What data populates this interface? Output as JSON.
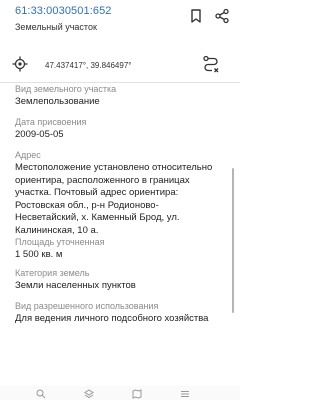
{
  "header": {
    "cadastral_number": "61:33:0030501:652",
    "subtitle": "Земельный участок",
    "bookmark_icon": "bookmark-icon",
    "share_icon": "share-icon",
    "accent_color": "#2f6fc9"
  },
  "location": {
    "coordinates": "47.437417°, 39.846497°",
    "target_icon": "crosshair-icon",
    "route_icon": "route-icon"
  },
  "fields": [
    {
      "label": "Вид земельного участка",
      "value": "Землепользование"
    },
    {
      "label": "Дата присвоения",
      "value": "2009-05-05"
    },
    {
      "label": "Адрес",
      "value": "Местоположение установлено относительно ориентира, расположенного в границах участка. Почтовый адрес ориентира: Ростовская обл., р-н Родионово-Несветайский, х. Каменный Брод, ул. Калининская, 10 а."
    },
    {
      "label": "Площадь уточненная",
      "value": "1 500 кв. м"
    },
    {
      "label": "Категория земель",
      "value": "Земли населенных пунктов"
    },
    {
      "label": "Вид разрешенного использования",
      "value": "Для ведения личного подсобного хозяйства"
    }
  ]
}
